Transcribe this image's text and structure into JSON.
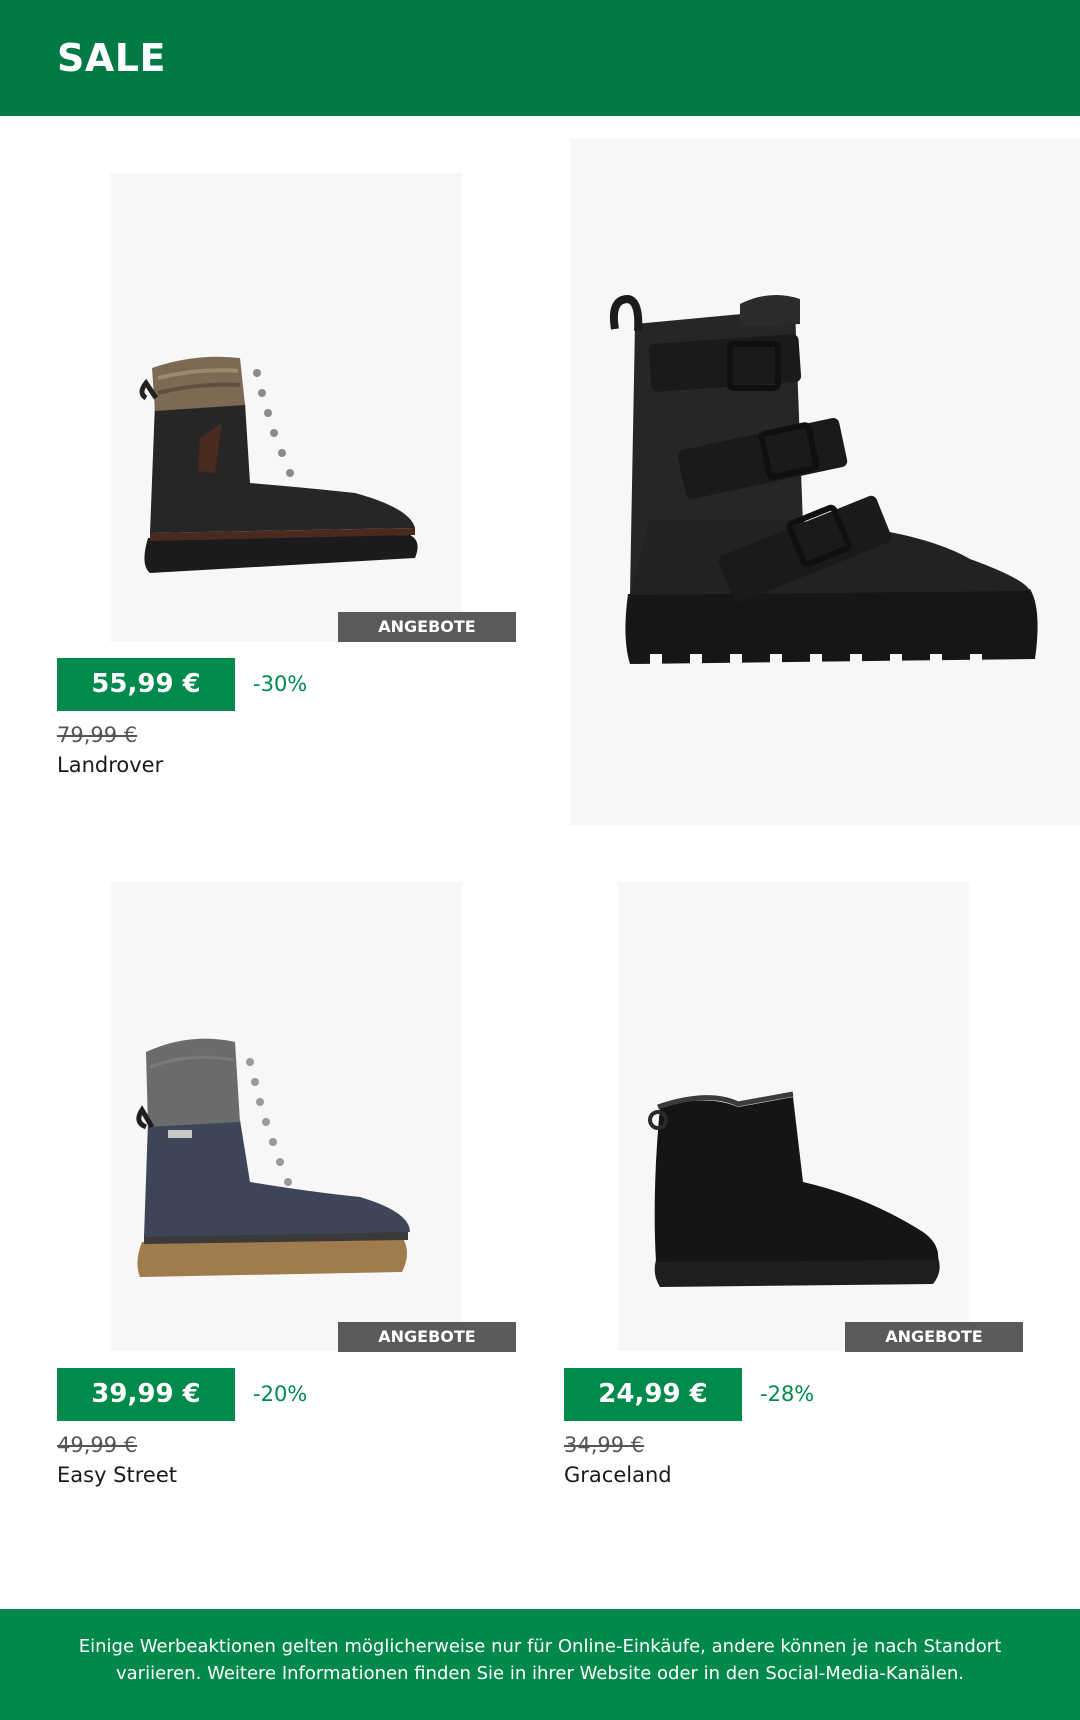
{
  "header": {
    "title": "SALE"
  },
  "products": [
    {
      "badge": "ANGEBOTE",
      "price": "55,99 €",
      "discount": "-30%",
      "old_price": "79,99 €",
      "name": "Landrover"
    },
    {
      "badge": "ANGEBOTE",
      "price": "39,99 €",
      "discount": "-20%",
      "old_price": "49,99 €",
      "name": "Easy Street"
    },
    {
      "badge": "ANGEBOTE",
      "price": "24,99 €",
      "discount": "-28%",
      "old_price": "34,99 €",
      "name": "Graceland"
    }
  ],
  "footer": {
    "text": "Einige Werbeaktionen gelten möglicherweise nur für Online-Einkäufe, andere können je nach Standort variieren. Weitere Informationen finden Sie in ihrer Website oder in den Social-Media-Kanälen."
  },
  "colors": {
    "brand_green": "#007a45",
    "price_green": "#008a4b",
    "badge_gray": "#5a5a5a"
  }
}
